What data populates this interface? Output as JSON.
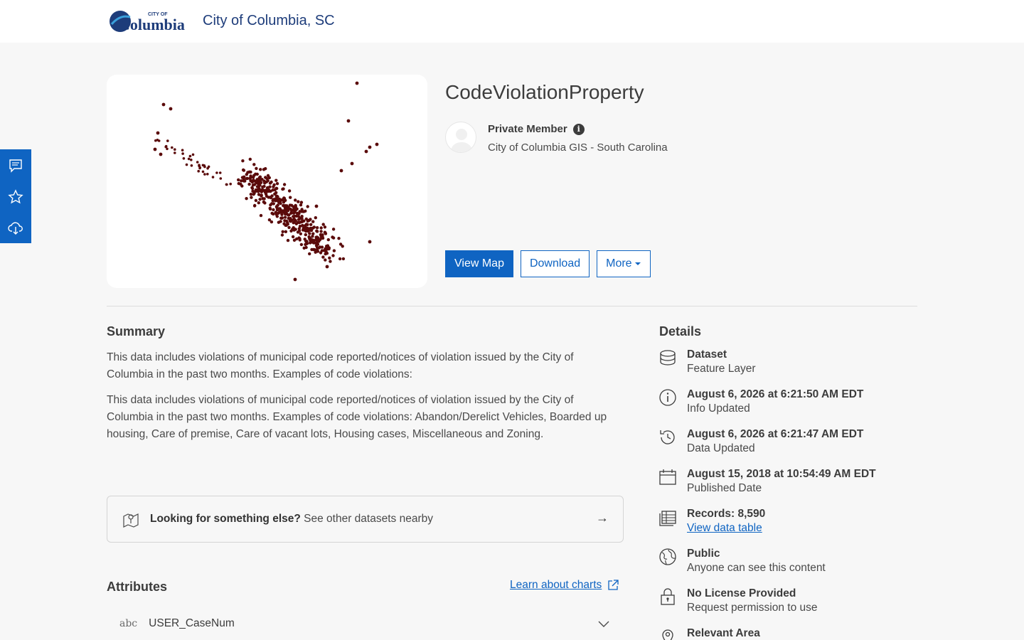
{
  "header": {
    "logo_text": "Columbia",
    "logo_small": "CITY OF",
    "site_title": "City of Columbia, SC"
  },
  "siderail": {
    "items": [
      {
        "icon": "comment-icon"
      },
      {
        "icon": "star-icon"
      },
      {
        "icon": "cloud-download-icon"
      }
    ]
  },
  "item": {
    "title": "CodeViolationProperty",
    "owner": "Private Member",
    "org": "City of Columbia GIS - South Carolina"
  },
  "actions": {
    "view_map": "View Map",
    "download": "Download",
    "more": "More"
  },
  "summary": {
    "heading": "Summary",
    "short": "This data includes violations of municipal code reported/notices of violation issued by the City of Columbia in the past two months. Examples of code violations:",
    "long": "This data includes violations of municipal code reported/notices of violation issued by the City of Columbia in the past two months. Examples of code violations: Abandon/Derelict Vehicles, Boarded up housing, Care of premise, Care of vacant lots, Housing cases, Miscellaneous and Zoning."
  },
  "lookbox": {
    "bold": "Looking for something else?",
    "rest": " See other datasets nearby",
    "arrow": "→"
  },
  "attributes": {
    "heading": "Attributes",
    "learn_link": "Learn about charts",
    "rows": [
      {
        "type": "abc",
        "name": "USER_CaseNum"
      }
    ]
  },
  "details": {
    "heading": "Details",
    "items": [
      {
        "icon": "database-icon",
        "t1": "Dataset",
        "t2": "Feature Layer"
      },
      {
        "icon": "info-icon",
        "t1": "August 6, 2026 at 6:21:50 AM EDT",
        "t2": "Info Updated"
      },
      {
        "icon": "history-icon",
        "t1": "August 6, 2026 at 6:21:47 AM EDT",
        "t2": "Data Updated"
      },
      {
        "icon": "calendar-icon",
        "t1": "August 15, 2018 at 10:54:49 AM EDT",
        "t2": "Published Date"
      },
      {
        "icon": "table-icon",
        "t1": "Records: 8,590",
        "t2": "View data table"
      },
      {
        "icon": "globe-icon",
        "t1": "Public",
        "t2": "Anyone can see this content"
      },
      {
        "icon": "lock-icon",
        "t1": "No License Provided",
        "t2": "Request permission to use"
      },
      {
        "icon": "pin-icon",
        "t1": "Relevant Area",
        "t2": ""
      }
    ]
  },
  "colors": {
    "brand": "#0f64c2",
    "title_blue": "#1d3c7a",
    "points": "#5a0a0a"
  }
}
